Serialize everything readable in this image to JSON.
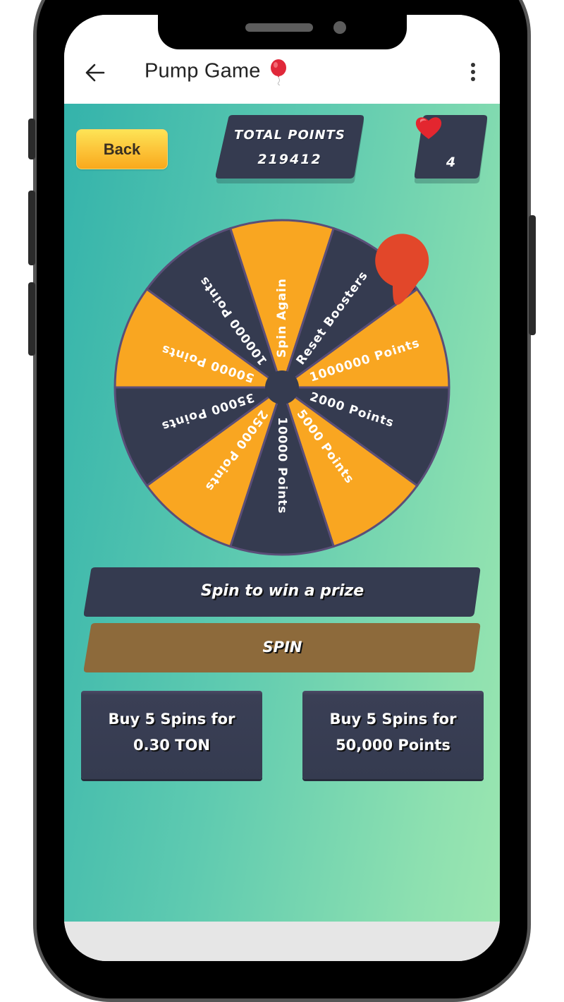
{
  "app": {
    "title": "Pump Game",
    "title_emoji_icon": "balloon-icon",
    "back_icon": "arrow-left-icon",
    "menu_icon": "kebab-menu-icon"
  },
  "game": {
    "back_button_label": "Back",
    "total_points_label": "TOTAL POINTS",
    "total_points_value": "219412",
    "lives_icon": "heart-icon",
    "lives_value": "4",
    "pointer_icon": "teardrop-pointer-icon",
    "wheel": {
      "segments": [
        {
          "label": "1000000 Points",
          "color": "#f9a621"
        },
        {
          "label": "2000 Points",
          "color": "#353b50"
        },
        {
          "label": "5000 Points",
          "color": "#f9a621"
        },
        {
          "label": "10000 Points",
          "color": "#353b50"
        },
        {
          "label": "25000 Points",
          "color": "#f9a621"
        },
        {
          "label": "35000 Points",
          "color": "#353b50"
        },
        {
          "label": "50000 Points",
          "color": "#f9a621"
        },
        {
          "label": "100000 Points",
          "color": "#353b50"
        },
        {
          "label": "Spin Again",
          "color": "#f9a621"
        },
        {
          "label": "Reset Boosters",
          "color": "#353b50"
        }
      ],
      "divider_color": "#5a4e78",
      "hub_color": "#353b50",
      "pointer_color": "#e2472a"
    },
    "status_banner": "Spin to win a prize",
    "spin_button_label": "SPIN",
    "buy_options": [
      {
        "line1": "Buy 5 Spins for",
        "line2": "0.30 TON"
      },
      {
        "line1": "Buy 5 Spins for",
        "line2": "50,000 Points"
      }
    ]
  },
  "colors": {
    "panel": "#353b50",
    "accent_yellow": "#fcc53a",
    "spin_button": "#8d6a3b",
    "pointer": "#e2472a"
  }
}
